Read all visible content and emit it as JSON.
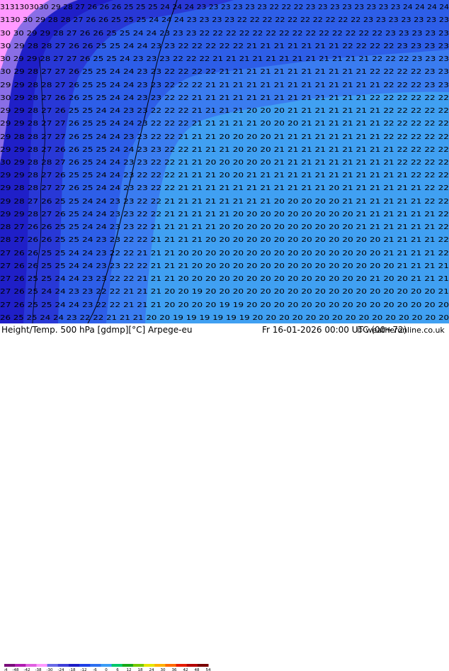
{
  "footer": {
    "title": "Height/Temp. 500 hPa [gdmp][°C] Arpege-eu",
    "valid": "Fr 16-01-2026 00:00 UTC (00+72)",
    "credit": "© weatheronline.co.uk"
  },
  "legend": {
    "ticks": [
      "-54",
      "-48",
      "-42",
      "-38",
      "-30",
      "-24",
      "-18",
      "-12",
      "-6",
      "0",
      "6",
      "12",
      "18",
      "24",
      "30",
      "36",
      "42",
      "48",
      "54"
    ],
    "colors": [
      "#7b0d7b",
      "#b01cb0",
      "#e060e0",
      "#ff99ff",
      "#6a6ae6",
      "#3f3fd8",
      "#1c1cc6",
      "#1e3fe6",
      "#2d6ff0",
      "#3a9cf5",
      "#00c86a",
      "#18a818",
      "#78c800",
      "#e6e600",
      "#ffb000",
      "#ff6a00",
      "#e61c00",
      "#b40000",
      "#7a0000"
    ]
  },
  "map": {
    "colors": {
      "pink": "#ff99ff",
      "violet": "#8a6ee6",
      "navy": "#1f1fc8",
      "deep_blue": "#2838d6",
      "blue": "#2d5ee8",
      "mid_blue": "#3a7cf0",
      "light_blue": "#40a0f2",
      "label": "#000000",
      "contour": "#000000"
    },
    "rows": [
      "3131303030 29 28 27 26 26 26 25 25 25 24 24 24 23 23 23 23 23 23 22 22 22 23 23 23 23 23 23 23 23 24 24 24 24",
      "3130 30 29 28 28 27 26 26 25 25 25 24 24 24 23 23 23 23 22 22 22 22 22 22 22 22 22 22 23 23 23 23 23 23 23",
      "30 30 29 29 28 27 26 26 25 25 24 24 23 23 23 22 22 22 22 22 22 22 22 22 22 22 22 22 22 23 23 23 23 23",
      "30 29 28 28 27 26 26 25 25 24 24 23 23 22 22 22 22 22 21 21 21 21 21 21 21 22 22 22 22 23 23 23 23",
      "30 29 29 28 27 27 26 25 25 24 23 23 23 22 22 22 21 21 21 21 21 21 21 21 21 21 21 21 22 22 22 23 23 23",
      "30 29 28 27 27 26 25 25 24 24 23 23 22 22 22 22 21 21 21 21 21 21 21 21 21 21 21 22 22 22 22 23 23",
      "29 29 28 28 27 26 25 25 24 24 23 23 22 22 22 21 21 21 21 21 21 21 21 21 21 21 21 21 22 22 22 23 23",
      "30 29 28 27 26 26 25 25 24 24 23 23 22 22 21 21 21 21 21 21 21 21 21 21 21 21 21 22 22 22 22 22 22",
      "29 29 28 27 26 25 25 24 24 23 23 22 22 22 21 21 21 21 20 20 20 21 21 21 21 21 21 21 22 22 22 22 22",
      "29 29 28 27 27 26 25 25 24 24 23 22 22 22 21 21 21 21 21 20 20 20 21 21 21 21 21 21 22 22 22 22 22",
      "29 28 28 27 27 26 25 24 24 23 23 22 22 21 21 21 20 20 20 20 21 21 21 21 21 21 21 21 22 22 22 22 22",
      "29 29 28 27 26 26 25 25 24 24 23 23 22 22 21 21 21 20 20 20 21 21 21 21 21 21 21 21 21 22 22 22 22",
      "30 29 28 28 27 26 25 24 24 23 23 22 22 21 21 20 20 20 20 20 21 21 21 21 21 21 21 21 21 22 22 22 22",
      "29 29 28 27 26 25 25 24 24 23 22 22 22 21 21 21 20 20 21 21 21 21 21 21 21 21 21 21 21 21 22 22 22",
      "29 28 28 27 27 26 25 24 24 23 23 22 22 21 21 21 21 21 21 21 21 21 21 21 20 21 21 21 21 21 21 22 22",
      "29 28 27 26 25 25 24 24 23 23 22 22 21 21 21 21 21 21 21 21 20 20 20 20 20 21 21 21 21 21 21 22 22",
      "29 29 28 27 26 25 24 24 23 23 22 22 21 21 21 21 21 20 20 20 20 20 20 20 20 20 21 21 21 21 21 21 22",
      "28 27 26 26 25 25 24 24 23 23 22 21 21 21 21 21 20 20 20 20 20 20 20 20 20 20 21 21 21 21 21 21 22",
      "28 27 26 26 25 25 24 23 23 22 22 21 21 21 21 20 20 20 20 20 20 20 20 20 20 20 20 20 21 21 21 21 22",
      "27 26 26 25 25 24 24 23 22 22 21 21 21 20 20 20 20 20 20 20 20 20 20 20 20 20 20 20 21 21 21 21 22",
      "27 26 26 25 25 24 24 23 23 22 22 21 21 21 20 20 20 20 20 20 20 20 20 20 20 20 20 20 20 21 21 21 21",
      "27 26 25 25 24 24 23 23 22 22 21 21 21 20 20 20 20 20 20 20 20 20 20 20 20 20 20 21 20 20 21 21 21",
      "27 26 25 24 24 23 23 22 22 21 21 21 20 20 19 20 20 20 20 20 20 20 20 20 20 20 20 20 20 20 20 20 21",
      "27 26 25 25 24 24 23 22 22 21 21 21 20 20 20 20 19 19 20 20 20 20 20 20 20 20 20 20 20 20 20 20 20",
      "26 25 25 24 24 23 22 22 21 21 21 20 20 19 19 19 19 19 19 20 20 20 20 20 20 20 20 20 20 20 20 20 20 20"
    ]
  }
}
